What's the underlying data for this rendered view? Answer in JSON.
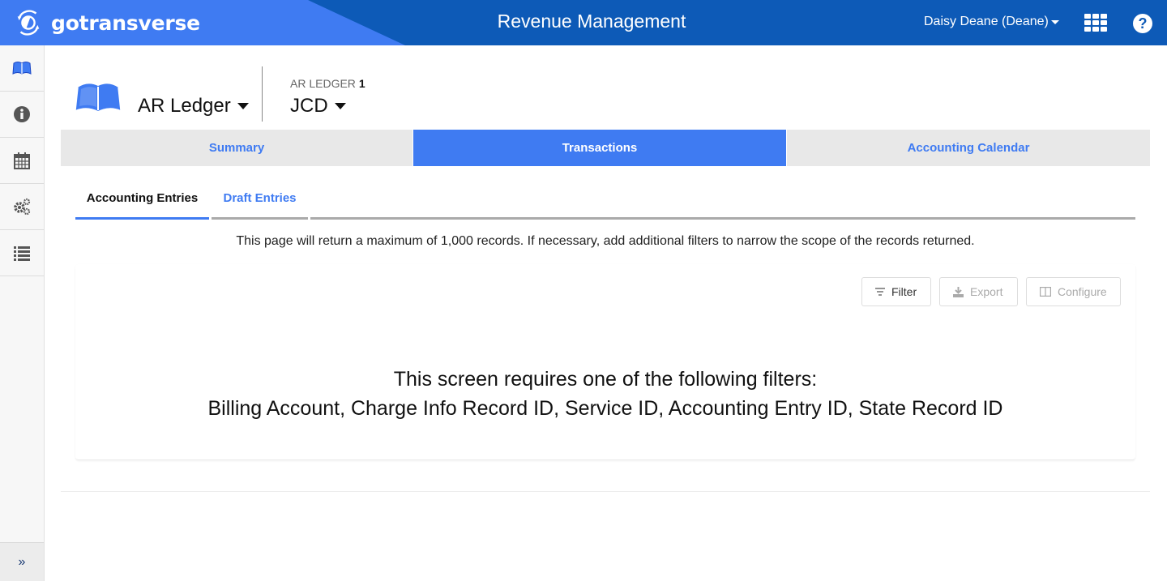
{
  "header": {
    "brand": "gotransverse",
    "app_title": "Revenue Management",
    "user": "Daisy Deane (Deane)",
    "apps_icon": "grid-icon",
    "help_icon": "help-icon",
    "help_glyph": "?"
  },
  "sidebar": {
    "items": [
      {
        "name": "ledger",
        "icon": "book-icon",
        "active": true
      },
      {
        "name": "info",
        "icon": "info-icon"
      },
      {
        "name": "calendar",
        "icon": "calendar-icon"
      },
      {
        "name": "settings",
        "icon": "gears-icon"
      },
      {
        "name": "list",
        "icon": "list-icon"
      }
    ],
    "expand_glyph": "»"
  },
  "page": {
    "ledger_select": "AR Ledger",
    "subtitle_label": "AR LEDGER",
    "subtitle_num": "1",
    "ledger_name": "JCD"
  },
  "main_tabs": [
    {
      "label": "Summary",
      "active": false
    },
    {
      "label": "Transactions",
      "active": true
    },
    {
      "label": "Accounting Calendar",
      "active": false
    }
  ],
  "sub_tabs": [
    {
      "label": "Accounting Entries",
      "active": true
    },
    {
      "label": "Draft Entries",
      "active": false
    }
  ],
  "notice": "This page will return a maximum of 1,000 records. If necessary, add additional filters to narrow the scope of the records returned.",
  "toolbar": {
    "filter_label": "Filter",
    "export_label": "Export",
    "configure_label": "Configure"
  },
  "requirement": {
    "line1": "This screen requires one of the following filters:",
    "line2": "Billing Account, Charge Info Record ID, Service ID, Accounting Entry ID, State Record ID"
  },
  "colors": {
    "brand_blue": "#3f7bf2",
    "header_dark": "#0d5ab7"
  }
}
